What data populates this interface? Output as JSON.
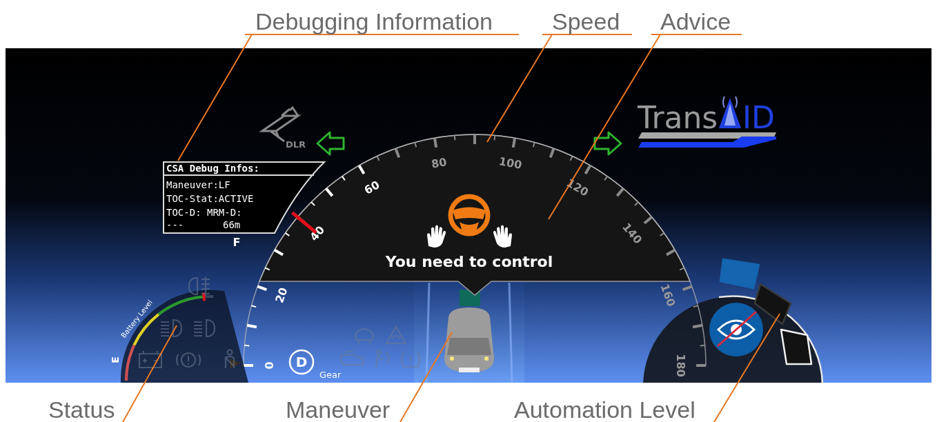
{
  "top_annotations": [
    "Debugging Information",
    "Speed",
    "Advice"
  ],
  "bottom_annotations": [
    "Status",
    "Maneuver",
    "Automation Level"
  ],
  "logos": {
    "dlr": "DLR",
    "transaid_left": "Trans",
    "transaid_right": "ID"
  },
  "turn_signals": [
    {
      "on": true
    },
    {
      "on": true
    }
  ],
  "debug_panel": {
    "title": "CSA Debug Infos:",
    "rows": [
      [
        "Maneuver:LF"
      ],
      [
        "TOC-Stat:ACTIVE"
      ],
      [
        "TOC-D: MRM-D:"
      ],
      [
        "---",
        "66m"
      ]
    ]
  },
  "battery": {
    "label": "Battery Level",
    "full_label": "F",
    "empty_label": "E",
    "level": 0.93
  },
  "status_icons": [
    {
      "kind": "fog-light",
      "on": false
    },
    {
      "kind": "low-beam",
      "on": false
    },
    {
      "kind": "high-beam",
      "on": false
    },
    {
      "kind": "battery",
      "on": false
    },
    {
      "kind": "brake",
      "on": false
    },
    {
      "kind": "seatbelt",
      "on": false
    },
    {
      "kind": "traction",
      "on": false
    },
    {
      "kind": "triangle",
      "on": false
    },
    {
      "kind": "engine",
      "on": false
    },
    {
      "kind": "airbag",
      "on": false
    },
    {
      "kind": "tire",
      "on": false
    }
  ],
  "speedometer": {
    "tick_labels": [
      "0",
      "20",
      "40",
      "60",
      "80",
      "100",
      "120",
      "140",
      "160",
      "180"
    ],
    "level": 0.222
  },
  "advice": {
    "text": "You need to control"
  },
  "gear": {
    "value": "D",
    "label": "Gear"
  },
  "automation": {
    "segments": [
      {
        "selected": true
      },
      {
        "selected": false
      },
      {
        "selected": false
      }
    ]
  }
}
